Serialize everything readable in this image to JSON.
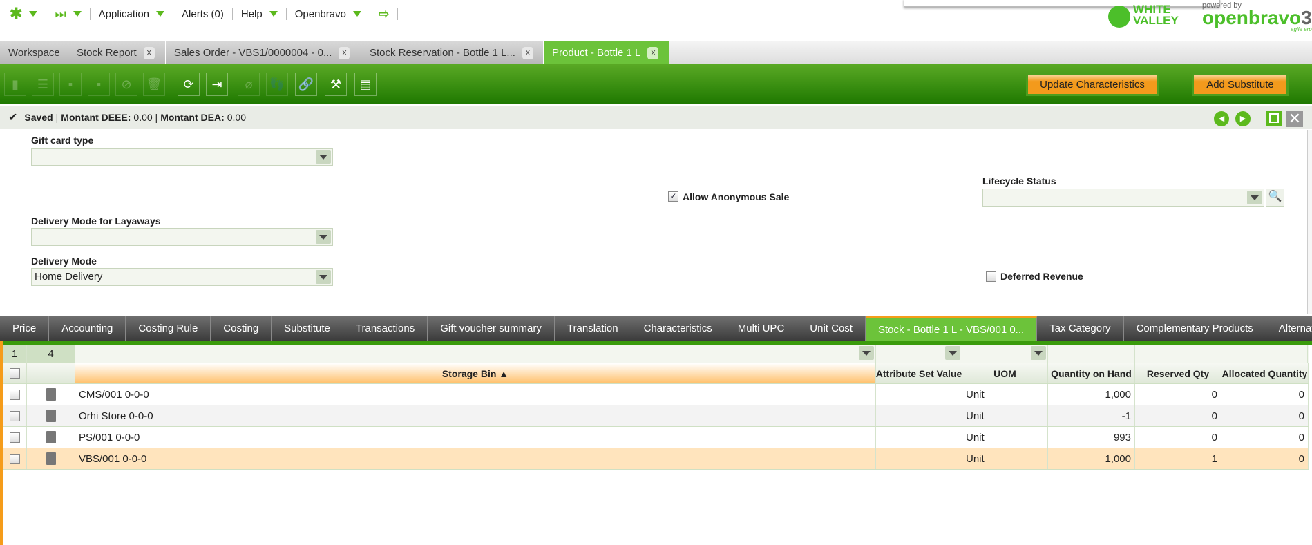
{
  "topnav": {
    "application": "Application",
    "alerts": "Alerts (0)",
    "help": "Help",
    "openbravo": "Openbravo"
  },
  "logos": {
    "white_valley": "WHITE VALLEY",
    "powered_by": "powered by",
    "openbravo": "openbravo",
    "version": "3",
    "tagline": "agile erp"
  },
  "tabs": [
    {
      "label": "Workspace"
    },
    {
      "label": "Stock Report"
    },
    {
      "label": "Sales Order - VBS1/0000004 - 0..."
    },
    {
      "label": "Stock Reservation - Bottle 1 L..."
    },
    {
      "label": "Product - Bottle 1 L"
    }
  ],
  "toolbar": {
    "update_characteristics": "Update Characteristics",
    "add_substitute": "Add Substitute"
  },
  "status": {
    "saved": "Saved",
    "deee_label": "Montant DEEE:",
    "deee_value": "0.00",
    "dea_label": "Montant DEA:",
    "dea_value": "0.00"
  },
  "form": {
    "gift_card_type": {
      "label": "Gift card type",
      "value": ""
    },
    "allow_anonymous_sale": {
      "label": "Allow Anonymous Sale",
      "checked": true
    },
    "lifecycle_status": {
      "label": "Lifecycle Status",
      "value": ""
    },
    "delivery_mode_layaways": {
      "label": "Delivery Mode for Layaways",
      "value": ""
    },
    "delivery_mode": {
      "label": "Delivery Mode",
      "value": "Home Delivery"
    },
    "deferred_revenue": {
      "label": "Deferred Revenue",
      "checked": false
    }
  },
  "subtabs": [
    "Price",
    "Accounting",
    "Costing Rule",
    "Costing",
    "Substitute",
    "Transactions",
    "Gift voucher summary",
    "Translation",
    "Characteristics",
    "Multi UPC",
    "Unit Cost",
    "Stock - Bottle 1 L - VBS/001 0...",
    "Tax Category",
    "Complementary Products",
    "Alternate"
  ],
  "grid": {
    "selected": "1",
    "total": "4",
    "columns": [
      "Storage Bin ▲",
      "Attribute Set Value",
      "UOM",
      "Quantity on Hand",
      "Reserved Qty",
      "Allocated Quantity"
    ],
    "rows": [
      [
        "CMS/001 0-0-0",
        "",
        "Unit",
        "1,000",
        "0",
        "0"
      ],
      [
        "Orhi Store 0-0-0",
        "",
        "Unit",
        "-1",
        "0",
        "0"
      ],
      [
        "PS/001 0-0-0",
        "",
        "Unit",
        "993",
        "0",
        "0"
      ],
      [
        "VBS/001 0-0-0",
        "",
        "Unit",
        "1,000",
        "1",
        "0"
      ]
    ]
  }
}
